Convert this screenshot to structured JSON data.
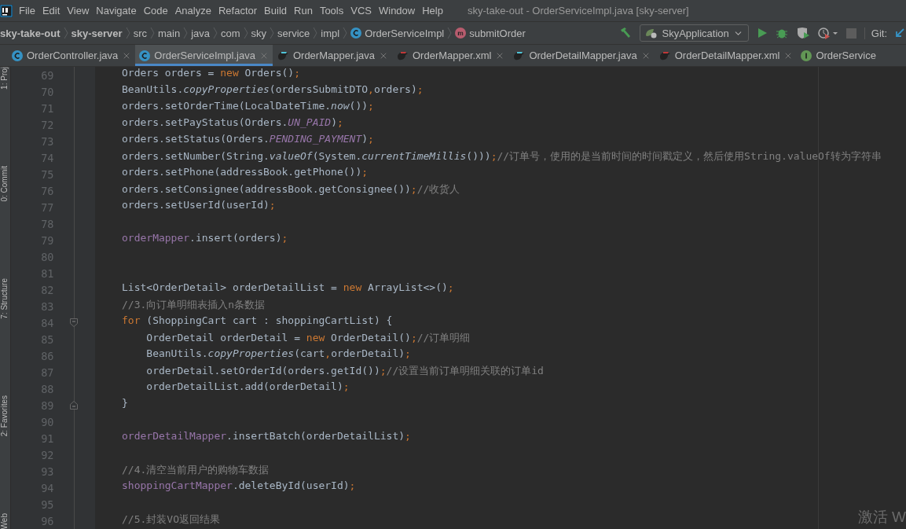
{
  "window": {
    "title": "sky-take-out - OrderServiceImpl.java [sky-server]"
  },
  "menu": [
    "File",
    "Edit",
    "View",
    "Navigate",
    "Code",
    "Analyze",
    "Refactor",
    "Build",
    "Run",
    "Tools",
    "VCS",
    "Window",
    "Help"
  ],
  "breadcrumbs": [
    {
      "label": "sky-take-out",
      "kind": "module"
    },
    {
      "label": "sky-server",
      "kind": "module"
    },
    {
      "label": "src",
      "kind": "folder"
    },
    {
      "label": "main",
      "kind": "folder"
    },
    {
      "label": "java",
      "kind": "folder"
    },
    {
      "label": "com",
      "kind": "folder"
    },
    {
      "label": "sky",
      "kind": "folder"
    },
    {
      "label": "service",
      "kind": "folder"
    },
    {
      "label": "impl",
      "kind": "folder"
    },
    {
      "label": "OrderServiceImpl",
      "kind": "class"
    },
    {
      "label": "submitOrder",
      "kind": "method"
    }
  ],
  "run_config": "SkyApplication",
  "git_label": "Git:",
  "side_tools": [
    {
      "label": "1: Proj"
    },
    {
      "label": "0: Commit"
    },
    {
      "label": "7: Structure"
    },
    {
      "label": "2: Favorites"
    },
    {
      "label": "Web"
    }
  ],
  "tabs": [
    {
      "label": "OrderController.java",
      "kind": "class",
      "selected": false,
      "closable": true
    },
    {
      "label": "OrderServiceImpl.java",
      "kind": "class",
      "selected": true,
      "closable": true
    },
    {
      "label": "OrderMapper.java",
      "kind": "mapper_java",
      "selected": false,
      "closable": true
    },
    {
      "label": "OrderMapper.xml",
      "kind": "mapper_xml",
      "selected": false,
      "closable": true
    },
    {
      "label": "OrderDetailMapper.java",
      "kind": "mapper_java",
      "selected": false,
      "closable": true
    },
    {
      "label": "OrderDetailMapper.xml",
      "kind": "mapper_xml",
      "selected": false,
      "closable": true
    },
    {
      "label": "OrderService",
      "kind": "interface",
      "selected": false,
      "closable": false
    }
  ],
  "editor": {
    "lines": [
      {
        "number": "69",
        "tokens": [
          {
            "kind": "plain",
            "text": "Orders orders = "
          },
          {
            "kind": "keyword",
            "text": "new"
          },
          {
            "kind": "plain",
            "text": " Orders()"
          },
          {
            "kind": "keyword",
            "text": ";"
          }
        ]
      },
      {
        "number": "70",
        "tokens": [
          {
            "kind": "plain",
            "text": "BeanUtils."
          },
          {
            "kind": "italic",
            "text": "copyProperties"
          },
          {
            "kind": "plain",
            "text": "(ordersSubmitDTO"
          },
          {
            "kind": "keyword",
            "text": ","
          },
          {
            "kind": "plain",
            "text": "orders)"
          },
          {
            "kind": "keyword",
            "text": ";"
          }
        ]
      },
      {
        "number": "71",
        "tokens": [
          {
            "kind": "plain",
            "text": "orders.setOrderTime(LocalDateTime."
          },
          {
            "kind": "italic",
            "text": "now"
          },
          {
            "kind": "plain",
            "text": "())"
          },
          {
            "kind": "keyword",
            "text": ";"
          }
        ]
      },
      {
        "number": "72",
        "tokens": [
          {
            "kind": "plain",
            "text": "orders.setPayStatus(Orders."
          },
          {
            "kind": "static",
            "text": "UN_PAID"
          },
          {
            "kind": "plain",
            "text": ")"
          },
          {
            "kind": "keyword",
            "text": ";"
          }
        ]
      },
      {
        "number": "73",
        "tokens": [
          {
            "kind": "plain",
            "text": "orders.setStatus(Orders."
          },
          {
            "kind": "static",
            "text": "PENDING_PAYMENT"
          },
          {
            "kind": "plain",
            "text": ")"
          },
          {
            "kind": "keyword",
            "text": ";"
          }
        ]
      },
      {
        "number": "74",
        "tokens": [
          {
            "kind": "plain",
            "text": "orders.setNumber(String."
          },
          {
            "kind": "italic",
            "text": "valueOf"
          },
          {
            "kind": "plain",
            "text": "(System."
          },
          {
            "kind": "italic",
            "text": "currentTimeMillis"
          },
          {
            "kind": "plain",
            "text": "()))"
          },
          {
            "kind": "keyword",
            "text": ";"
          },
          {
            "kind": "comment",
            "text": "//订单号，使用的是当前时间的时间戳定义，然后使用String.valueOf转为字符串"
          }
        ]
      },
      {
        "number": "75",
        "tokens": [
          {
            "kind": "plain",
            "text": "orders.setPhone(addressBook.getPhone())"
          },
          {
            "kind": "keyword",
            "text": ";"
          }
        ]
      },
      {
        "number": "76",
        "tokens": [
          {
            "kind": "plain",
            "text": "orders.setConsignee(addressBook.getConsignee())"
          },
          {
            "kind": "keyword",
            "text": ";"
          },
          {
            "kind": "comment",
            "text": "//收货人"
          }
        ]
      },
      {
        "number": "77",
        "tokens": [
          {
            "kind": "plain",
            "text": "orders.setUserId(userId)"
          },
          {
            "kind": "keyword",
            "text": ";"
          }
        ]
      },
      {
        "number": "78"
      },
      {
        "number": "79",
        "tokens": [
          {
            "kind": "field",
            "text": "orderMapper"
          },
          {
            "kind": "plain",
            "text": ".insert(orders)"
          },
          {
            "kind": "keyword",
            "text": ";"
          }
        ]
      },
      {
        "number": "80"
      },
      {
        "number": "81"
      },
      {
        "number": "82",
        "tokens": [
          {
            "kind": "plain",
            "text": "List<OrderDetail> orderDetailList = "
          },
          {
            "kind": "keyword",
            "text": "new"
          },
          {
            "kind": "plain",
            "text": " ArrayList<>()"
          },
          {
            "kind": "keyword",
            "text": ";"
          }
        ]
      },
      {
        "number": "83",
        "tokens": [
          {
            "kind": "comment",
            "text": "//3.向订单明细表插入n条数据"
          }
        ]
      },
      {
        "number": "84",
        "fold_start": true,
        "tokens": [
          {
            "kind": "keyword",
            "text": "for"
          },
          {
            "kind": "plain",
            "text": " (ShoppingCart cart : shoppingCartList) {"
          }
        ]
      },
      {
        "number": "85",
        "tokens": [
          {
            "kind": "plain",
            "text": "    OrderDetail orderDetail = "
          },
          {
            "kind": "keyword",
            "text": "new"
          },
          {
            "kind": "plain",
            "text": " OrderDetail()"
          },
          {
            "kind": "keyword",
            "text": ";"
          },
          {
            "kind": "comment",
            "text": "//订单明细"
          }
        ]
      },
      {
        "number": "86",
        "tokens": [
          {
            "kind": "plain",
            "text": "    BeanUtils."
          },
          {
            "kind": "italic",
            "text": "copyProperties"
          },
          {
            "kind": "plain",
            "text": "(cart"
          },
          {
            "kind": "keyword",
            "text": ","
          },
          {
            "kind": "plain",
            "text": "orderDetail)"
          },
          {
            "kind": "keyword",
            "text": ";"
          }
        ]
      },
      {
        "number": "87",
        "tokens": [
          {
            "kind": "plain",
            "text": "    orderDetail.setOrderId(orders.getId())"
          },
          {
            "kind": "keyword",
            "text": ";"
          },
          {
            "kind": "comment",
            "text": "//设置当前订单明细关联的订单id"
          }
        ]
      },
      {
        "number": "88",
        "tokens": [
          {
            "kind": "plain",
            "text": "    orderDetailList.add(orderDetail)"
          },
          {
            "kind": "keyword",
            "text": ";"
          }
        ]
      },
      {
        "number": "89",
        "fold_end": true,
        "tokens": [
          {
            "kind": "plain",
            "text": "}"
          }
        ]
      },
      {
        "number": "90"
      },
      {
        "number": "91",
        "tokens": [
          {
            "kind": "field",
            "text": "orderDetailMapper"
          },
          {
            "kind": "plain",
            "text": ".insertBatch(orderDetailList)"
          },
          {
            "kind": "keyword",
            "text": ";"
          }
        ]
      },
      {
        "number": "92"
      },
      {
        "number": "93",
        "tokens": [
          {
            "kind": "comment",
            "text": "//4.清空当前用户的购物车数据"
          }
        ]
      },
      {
        "number": "94",
        "tokens": [
          {
            "kind": "field",
            "text": "shoppingCartMapper"
          },
          {
            "kind": "plain",
            "text": ".deleteById(userId)"
          },
          {
            "kind": "keyword",
            "text": ";"
          }
        ]
      },
      {
        "number": "95"
      },
      {
        "number": "96",
        "tokens": [
          {
            "kind": "comment",
            "text": "//5.封装VO返回结果"
          }
        ]
      }
    ]
  },
  "os_notice": "激活 W"
}
